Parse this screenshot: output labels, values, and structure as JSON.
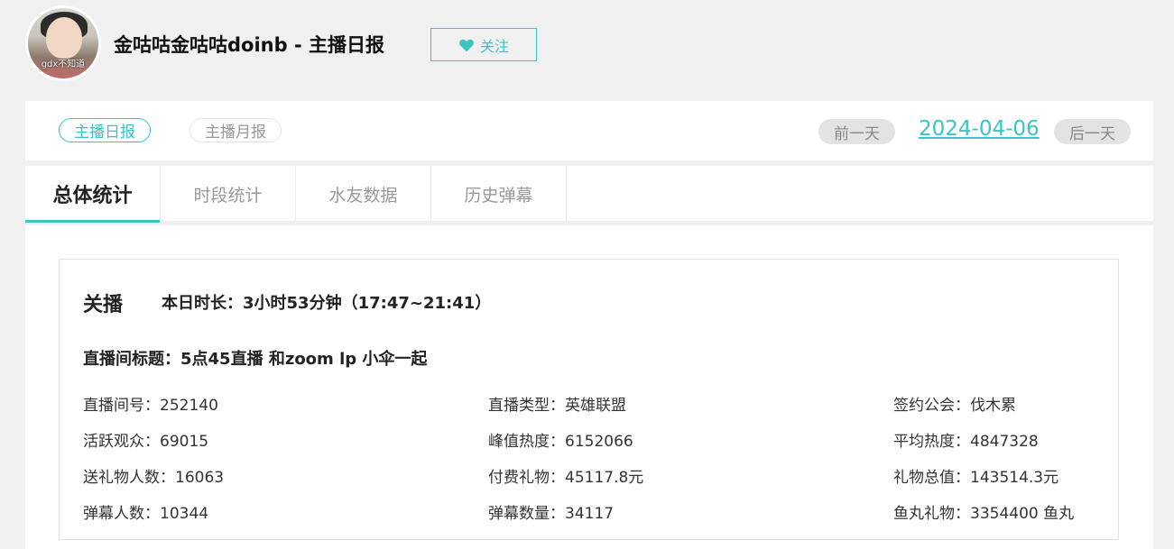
{
  "header": {
    "avatar_caption": "gdx不知道",
    "title": "金咕咕金咕咕doinb - 主播日报",
    "follow_label": "关注"
  },
  "report_bar": {
    "daily_label": "主播日报",
    "monthly_label": "主播月报",
    "prev_label": "前一天",
    "date": "2024-04-06",
    "next_label": "后一天"
  },
  "tabs": [
    {
      "label": "总体统计",
      "active": true
    },
    {
      "label": "时段统计",
      "active": false
    },
    {
      "label": "水友数据",
      "active": false
    },
    {
      "label": "历史弹幕",
      "active": false
    }
  ],
  "summary": {
    "live_label": "关播",
    "duration": "本日时长：3小时53分钟（17:47~21:41）",
    "room_title": "直播间标题：5点45直播 和zoom lp 小伞一起",
    "stats": [
      [
        "直播间号：252140",
        "直播类型：英雄联盟",
        "签约公会：伐木累"
      ],
      [
        "活跃观众：69015",
        "峰值热度：6152066",
        "平均热度：4847328"
      ],
      [
        "送礼物人数：16063",
        "付费礼物：45117.8元",
        "礼物总值：143514.3元"
      ],
      [
        "弹幕人数：10344",
        "弹幕数量：34117",
        "鱼丸礼物：3354400 鱼丸"
      ]
    ]
  },
  "colors": {
    "accent": "#3cc4c4",
    "page_bg": "#f0f0f0",
    "panel_bg": "#ffffff"
  }
}
